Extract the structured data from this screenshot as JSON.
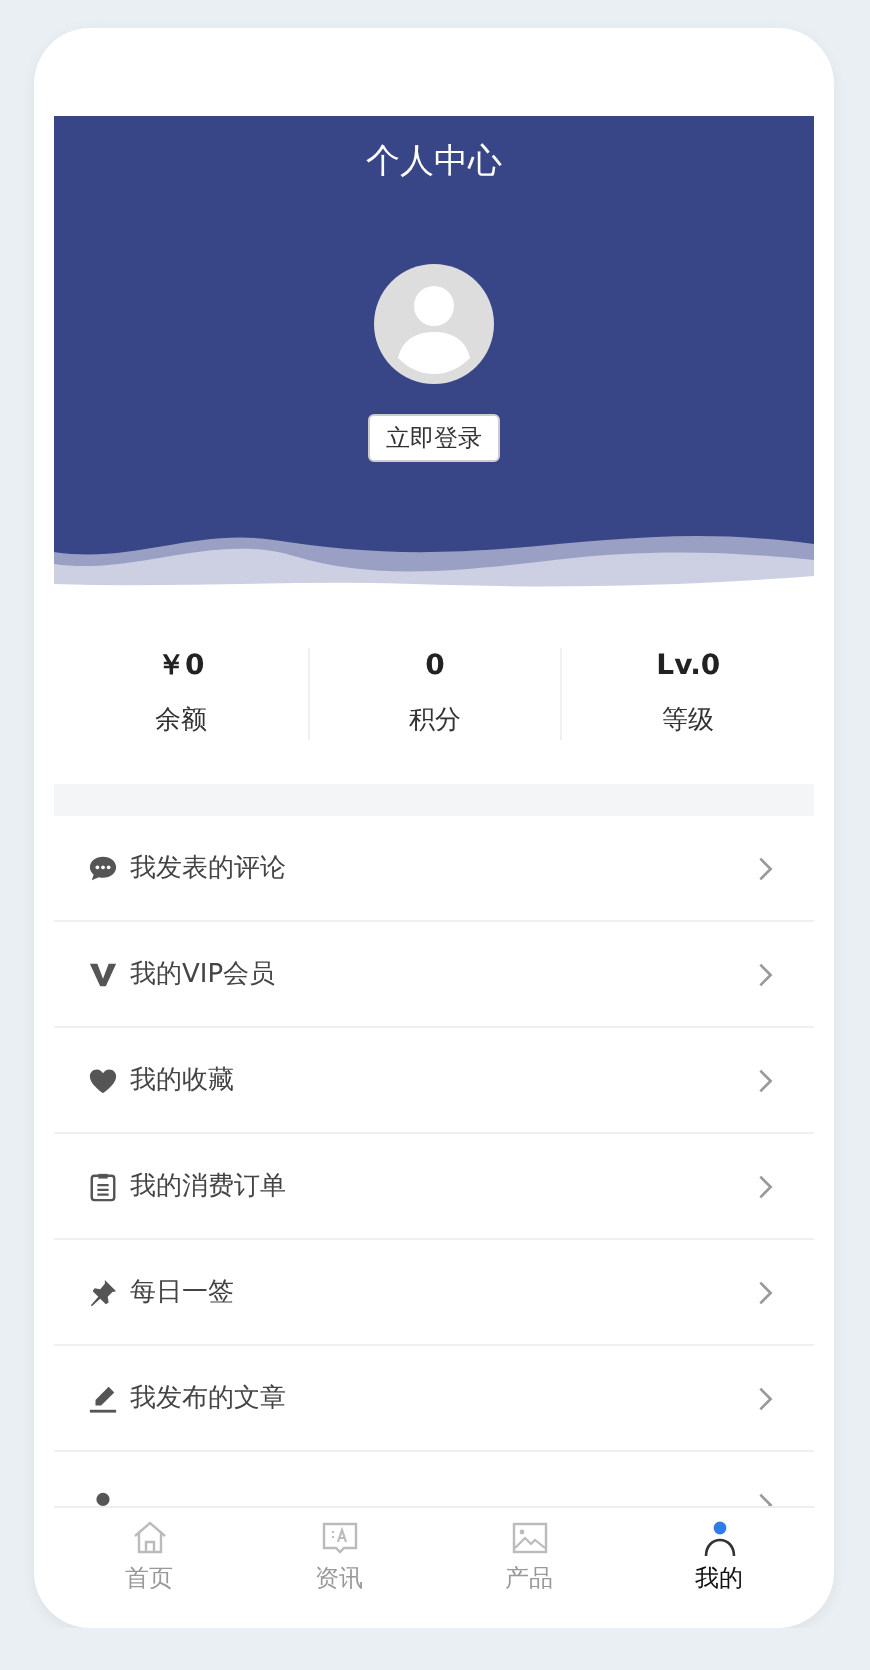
{
  "header": {
    "title": "个人中心",
    "login_button": "立即登录"
  },
  "stats": [
    {
      "value": "￥0",
      "label": "余额"
    },
    {
      "value": "0",
      "label": "积分"
    },
    {
      "value": "Lv.0",
      "label": "等级"
    }
  ],
  "menu": [
    {
      "label": "我发表的评论"
    },
    {
      "label": "我的VIP会员"
    },
    {
      "label": "我的收藏"
    },
    {
      "label": "我的消费订单"
    },
    {
      "label": "每日一签"
    },
    {
      "label": "我发布的文章"
    }
  ],
  "tabs": [
    {
      "label": "首页",
      "selected": false
    },
    {
      "label": "资讯",
      "selected": false
    },
    {
      "label": "产品",
      "selected": false
    },
    {
      "label": "我的",
      "selected": true
    }
  ]
}
